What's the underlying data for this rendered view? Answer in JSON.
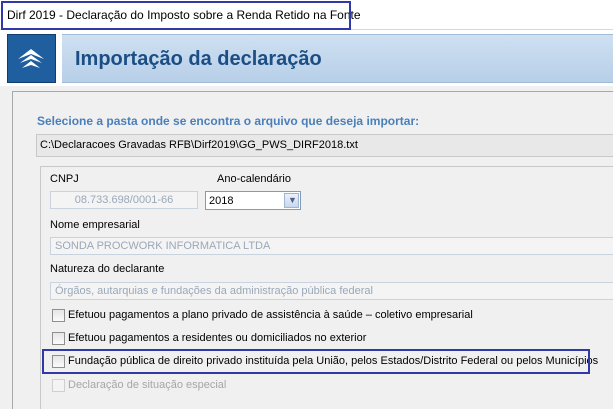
{
  "window": {
    "title": "Dirf 2019 - Declaração do Imposto sobre a Renda Retido na Fonte"
  },
  "header": {
    "title": "Importação da declaração",
    "logo_icon": "receita-federal-logo-icon"
  },
  "import": {
    "prompt": "Selecione a pasta onde se encontra o arquivo que deseja importar:",
    "path": "C:\\Declaracoes Gravadas RFB\\Dirf2019\\GG_PWS_DIRF2018.txt"
  },
  "declarant": {
    "cnpj_label": "CNPJ",
    "cnpj_value": "08.733.698/0001-66",
    "year_label": "Ano-calendário",
    "year_value": "2018",
    "name_label": "Nome empresarial",
    "name_value": "SONDA PROCWORK INFORMATICA LTDA",
    "nature_label": "Natureza do declarante",
    "nature_value": "Órgãos, autarquias e fundações da administração pública federal"
  },
  "options": [
    {
      "label": "Efetuou pagamentos a plano privado de assistência à saúde – coletivo empresarial",
      "checked": false,
      "enabled": true
    },
    {
      "label": "Efetuou pagamentos a residentes ou domiciliados no exterior",
      "checked": false,
      "enabled": true
    },
    {
      "label": "Fundação pública de direito privado instituída pela União, pelos Estados/Distrito Federal ou pelos Municípios",
      "checked": false,
      "enabled": true
    },
    {
      "label": "Declaração de situação especial",
      "checked": false,
      "enabled": false
    }
  ],
  "colors": {
    "header_title": "#1c4e86",
    "prompt": "#4a7fba",
    "highlight": "#2f3aa8"
  }
}
